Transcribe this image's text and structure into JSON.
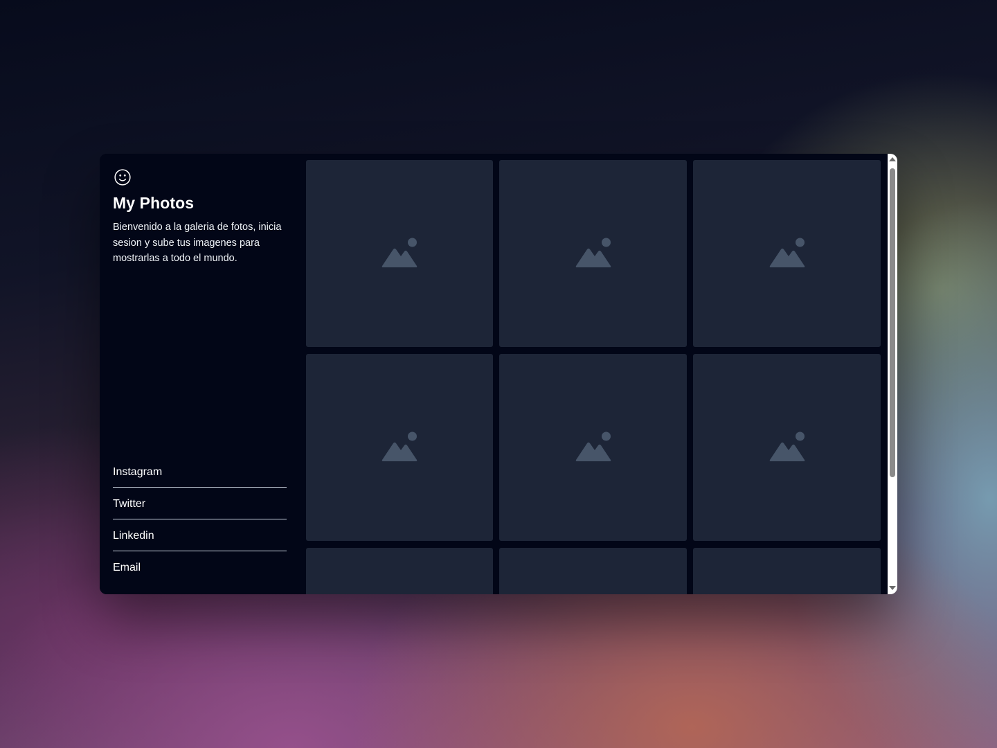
{
  "app": {
    "logo_icon": "smiley-face-icon",
    "title": "My Photos",
    "description": "Bienvenido a la galeria de fotos, inicia sesion y sube tus imagenes para mostrarlas a todo el mundo."
  },
  "social": {
    "links": [
      {
        "label": "Instagram"
      },
      {
        "label": "Twitter"
      },
      {
        "label": "Linkedin"
      },
      {
        "label": "Email"
      }
    ]
  },
  "gallery": {
    "placeholder_icon": "image-placeholder-icon",
    "photo_count_visible": 9
  },
  "theme": {
    "window_background": "#020617",
    "card_background": "#1d2537",
    "icon_color": "#475569",
    "text_color": "#ffffff",
    "divider_color": "#cbd5e1"
  }
}
